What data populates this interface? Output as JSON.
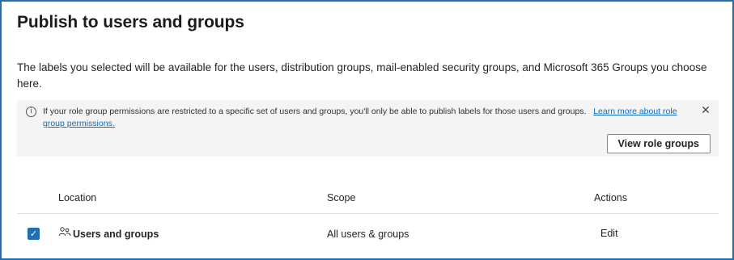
{
  "dialog": {
    "title": "Publish to users and groups",
    "description": "The labels you selected will be available for the users, distribution groups, mail-enabled security groups, and Microsoft 365 Groups you choose here."
  },
  "info_banner": {
    "icon": "info-icon",
    "icon_glyph": "i",
    "message": "If your role group permissions are restricted to a specific set of users and groups, you'll only be able to publish labels for those users and groups.",
    "link_text": "Learn more about role group permissions.",
    "close_glyph": "✕",
    "button_label": "View role groups"
  },
  "table": {
    "columns": [
      "Location",
      "Scope",
      "Actions"
    ],
    "rows": [
      {
        "checked": true,
        "check_glyph": "✓",
        "icon": "users-icon",
        "location": "Users and groups",
        "scope": "All users & groups",
        "action": "Edit"
      }
    ]
  },
  "colors": {
    "accent": "#1f6fb2",
    "link": "#0f6cbd",
    "banner_bg": "#f4f4f4"
  }
}
